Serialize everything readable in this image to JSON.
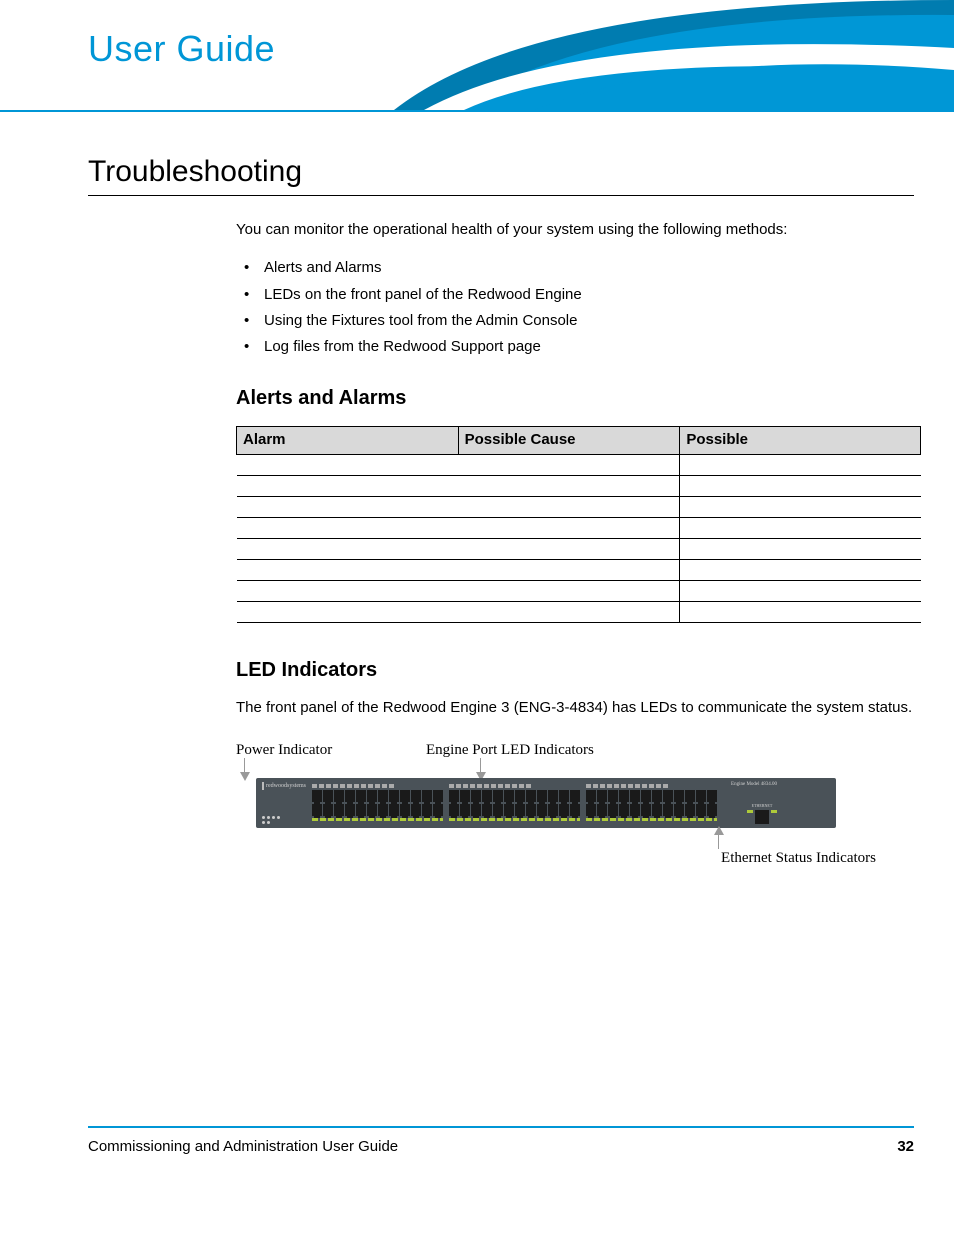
{
  "header": {
    "brand": "User Guide"
  },
  "page": {
    "title": "Troubleshooting",
    "intro": "You can monitor the operational health of your system using the following methods:",
    "bullets": [
      "Alerts and Alarms",
      "LEDs on the front panel of the Redwood Engine",
      "Using the Fixtures tool from the Admin Console",
      "Log files from the Redwood Support page"
    ]
  },
  "alerts_section": {
    "heading": "Alerts and Alarms",
    "table_headers": [
      "Alarm",
      "Possible Cause",
      "Possible"
    ],
    "empty_rows": 8
  },
  "led_section": {
    "heading": "LED Indicators",
    "desc": "The front panel of the Redwood Engine 3 (ENG-3-4834) has LEDs to communicate the system status.",
    "diagram": {
      "power_label": "Power Indicator",
      "engine_label": "Engine Port LED Indicators",
      "ethernet_label": "Ethernet Status Indicators",
      "device_brand": "redwoodsystems",
      "device_model": "Engine Model 4834.00",
      "eth_label": "ETHERNET"
    }
  },
  "footer": {
    "text": "Commissioning and Administration User Guide",
    "page_number": "32"
  }
}
